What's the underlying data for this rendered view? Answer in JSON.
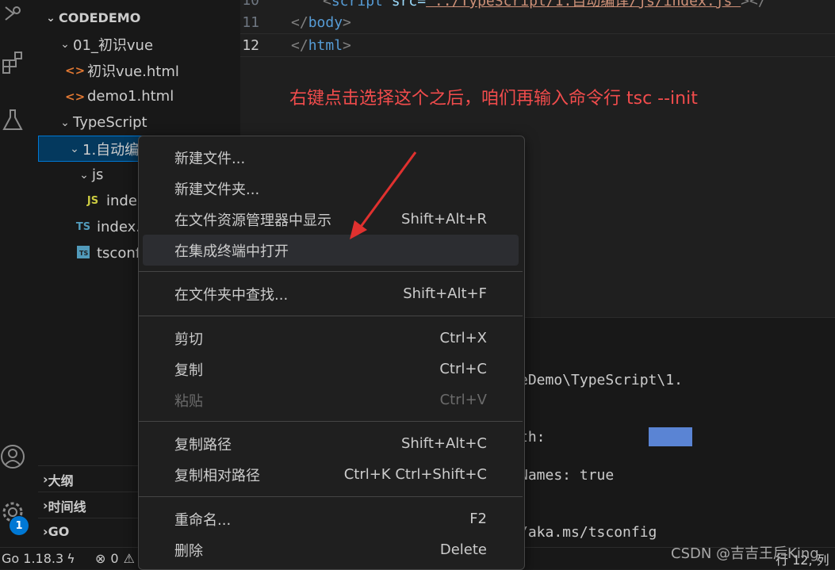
{
  "activity_bar": {
    "icons": [
      "debug-icon",
      "extensions-icon",
      "testing-icon",
      "account-icon",
      "settings-icon"
    ],
    "settings_badge": "1"
  },
  "explorer": {
    "root_title": "CODEDEMO",
    "items": [
      {
        "label": "01_初识vue",
        "icon": "chevron-down"
      },
      {
        "label": "初识vue.html",
        "icon": "html-file"
      },
      {
        "label": "demo1.html",
        "icon": "html-file"
      },
      {
        "label": "TypeScript",
        "icon": "chevron-down"
      },
      {
        "label": "1.自动编",
        "icon": "chevron-down"
      },
      {
        "label": "js",
        "icon": "chevron-down"
      },
      {
        "label": "inde",
        "icon": "js-file"
      },
      {
        "label": "index.",
        "icon": "ts-file"
      },
      {
        "label": "tsconf",
        "icon": "tsconfig-file"
      }
    ],
    "js_badge": "JS",
    "ts_badge": "TS",
    "sections": [
      "大纲",
      "时间线",
      "GO"
    ]
  },
  "editor": {
    "lines": [
      {
        "num": "10",
        "pre": "<",
        "tag": "script",
        "attr": " src=",
        "str": "\"../TypeScript/1.自动编译/js/index.js\"",
        "post": "></"
      },
      {
        "num": "11",
        "text_open": "</",
        "tag": "body",
        "text_close": ">"
      },
      {
        "num": "12",
        "text_open": "</",
        "tag": "html",
        "text_close": ">"
      }
    ]
  },
  "annotation_text": "右键点击选择这个之后，咱们再输入命令行 tsc --init",
  "terminal": {
    "lines": [
      "eDemo\\TypeScript\\1.",
      "th:",
      "Names: true",
      "/aka.ms/tsconfig"
    ]
  },
  "context_menu": {
    "items": [
      {
        "label": "新建文件...",
        "shortcut": ""
      },
      {
        "label": "新建文件夹...",
        "shortcut": ""
      },
      {
        "label": "在文件资源管理器中显示",
        "shortcut": "Shift+Alt+R"
      },
      {
        "label": "在集成终端中打开",
        "shortcut": ""
      },
      {
        "label": "在文件夹中查找...",
        "shortcut": "Shift+Alt+F"
      },
      {
        "label": "剪切",
        "shortcut": "Ctrl+X"
      },
      {
        "label": "复制",
        "shortcut": "Ctrl+C"
      },
      {
        "label": "粘贴",
        "shortcut": "Ctrl+V"
      },
      {
        "label": "复制路径",
        "shortcut": "Shift+Alt+C"
      },
      {
        "label": "复制相对路径",
        "shortcut": "Ctrl+K Ctrl+Shift+C"
      },
      {
        "label": "重命名...",
        "shortcut": "F2"
      },
      {
        "label": "删除",
        "shortcut": "Delete"
      }
    ]
  },
  "status_bar": {
    "go_version": "Go 1.18.3",
    "errors": "0",
    "position": "行 12, 列"
  },
  "watermark": "CSDN @吉吉王后King",
  "colors": {
    "accent": "#0078d4",
    "annotation": "#f14c4c",
    "arrow": "#e0312f"
  }
}
